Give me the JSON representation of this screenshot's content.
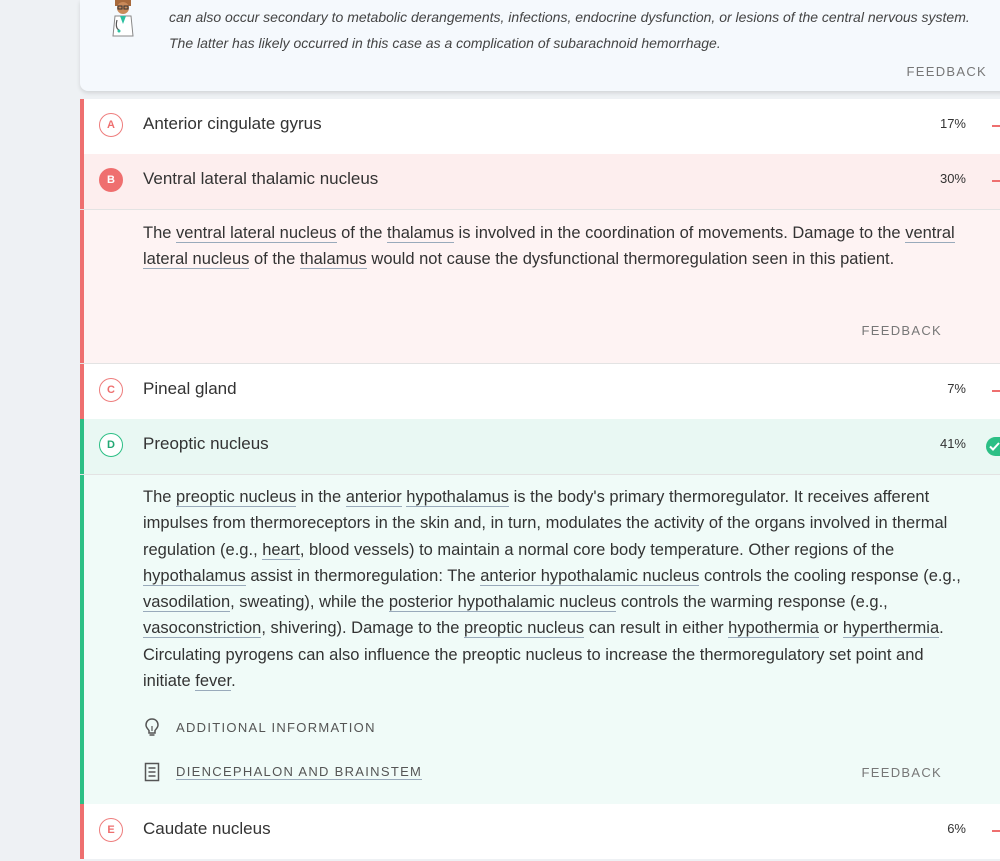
{
  "explanation": {
    "line1": "can also occur secondary to metabolic derangements, infections, endocrine dysfunction, or lesions of the central nervous system.",
    "line2": "The latter has likely occurred in this case as a complication of subarachnoid hemorrhage.",
    "feedback": "FEEDBACK"
  },
  "options": [
    {
      "letter": "A",
      "label": "Anterior cingulate gyrus",
      "percent": "17%"
    },
    {
      "letter": "B",
      "label": "Ventral lateral thalamic nucleus",
      "percent": "30%"
    },
    {
      "letter": "C",
      "label": "Pineal gland",
      "percent": "7%"
    },
    {
      "letter": "D",
      "label": "Preoptic nucleus",
      "percent": "41%"
    },
    {
      "letter": "E",
      "label": "Caudate nucleus",
      "percent": "6%"
    }
  ],
  "panel_b": {
    "t1": "The ",
    "l1": "ventral lateral nucleus",
    "t2": " of the ",
    "l2": "thalamus",
    "t3": " is involved in the coordination of movements. Damage to the ",
    "l3": "ventral lateral nucleus",
    "t4": " of the ",
    "l4": "thalamus",
    "t5": " would not cause the dysfunctional thermoregulation seen in this patient.",
    "feedback": "FEEDBACK"
  },
  "panel_d": {
    "t1": "The ",
    "l1": "preoptic nucleus",
    "t2": " in the ",
    "l2": "anterior",
    "t3": " ",
    "l3": "hypothalamus",
    "t4": " is the body's primary thermoregulator. It receives afferent impulses from thermoreceptors in the skin and, in turn, modulates the activity of the organs involved in thermal regulation (e.g., ",
    "l4": "heart",
    "t5": ", blood vessels) to maintain a normal core body temperature. Other regions of the ",
    "l5": "hypothalamus",
    "t6": " assist in thermoregulation: The ",
    "l6": "anterior hypothalamic nucleus",
    "t7": " controls the cooling response (e.g., ",
    "l7": "vasodilation",
    "t8": ", sweating), while the ",
    "l8": "posterior hypothalamic nucleus",
    "t9": " controls the warming response (e.g., ",
    "l9": "vasoconstriction",
    "t10": ", shivering). Damage to the ",
    "l10": "preoptic nucleus",
    "t11": " can result in either ",
    "l11": "hypothermia",
    "t12": " or ",
    "l12": "hyperthermia",
    "t13": ". Circulating pyrogens can also influence the preoptic nucleus to increase the thermoregulatory set point and initiate ",
    "l13": "fever",
    "t14": ".",
    "additional_info": "ADDITIONAL INFORMATION",
    "article_link": "DIENCEPHALON AND BRAINSTEM",
    "feedback": "FEEDBACK"
  },
  "colors": {
    "wrong": "#ee6f6f",
    "correct": "#2cbf85",
    "wrong_bg": "#fdeeee",
    "correct_bg": "#e9f8f3"
  },
  "icons": [
    "doctor-avatar-icon",
    "checkmark-icon",
    "lightbulb-icon",
    "article-icon"
  ]
}
